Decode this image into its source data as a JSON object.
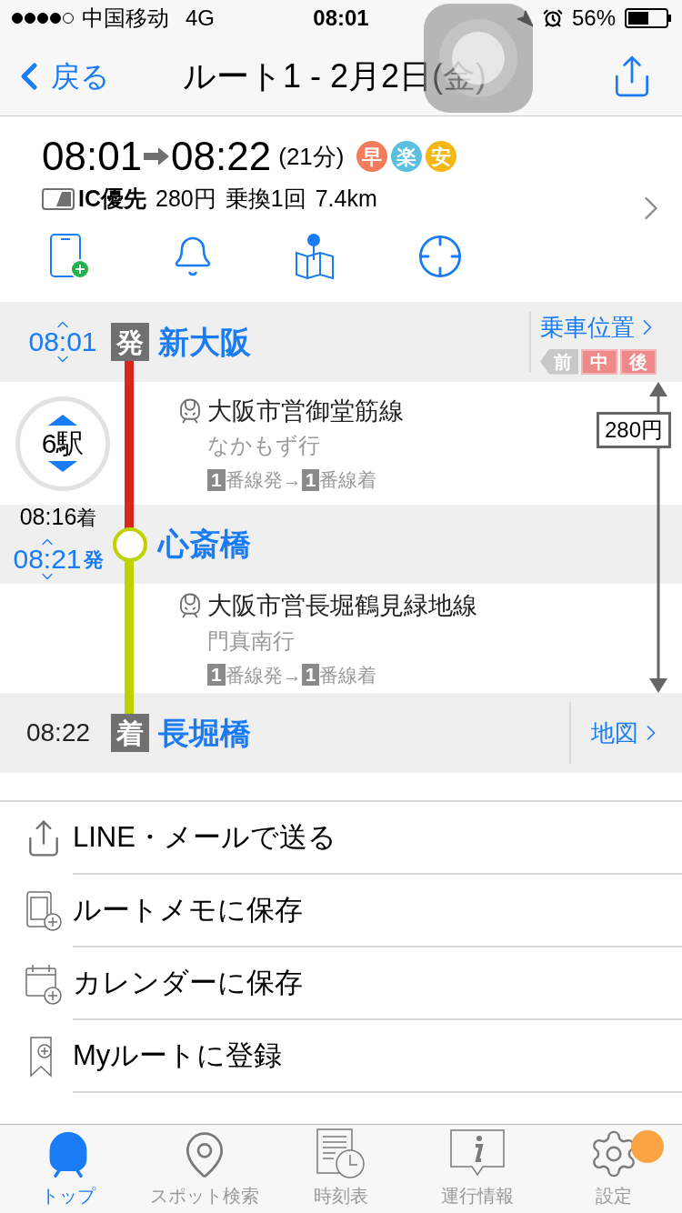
{
  "status_bar": {
    "carrier": "中国移动",
    "network": "4G",
    "time": "08:01",
    "battery": "56%"
  },
  "nav": {
    "back": "戻る",
    "title": "ルート1 - 2月2日(金)"
  },
  "summary": {
    "depart": "08:01",
    "arrive": "08:22",
    "duration": "(21分)",
    "badges": [
      {
        "label": "早",
        "color": "#f47c5c"
      },
      {
        "label": "楽",
        "color": "#5bbfe0"
      },
      {
        "label": "安",
        "color": "#f5b716"
      }
    ],
    "ic_label": "IC優先",
    "fare": "280円",
    "transfers": "乗換1回",
    "distance": "7.4km"
  },
  "route": {
    "origin": {
      "time": "08:01",
      "badge": "発",
      "name": "新大阪",
      "boarding_link": "乗車位置",
      "cars": [
        {
          "label": "前",
          "selected": false
        },
        {
          "label": "中",
          "selected": true
        },
        {
          "label": "後",
          "selected": true
        }
      ]
    },
    "segments": [
      {
        "stops": "6駅",
        "line": "大阪市営御堂筋線",
        "destination": "なかもず行",
        "platform_from": "1",
        "from_text": "番線発→",
        "platform_to": "1",
        "to_text": "番線着",
        "color": "#d9261c"
      },
      {
        "line": "大阪市営長堀鶴見緑地線",
        "destination": "門真南行",
        "platform_from": "1",
        "from_text": "番線発→",
        "platform_to": "1",
        "to_text": "番線着",
        "color": "#bfd200"
      }
    ],
    "transfer": {
      "arrive": "08:16",
      "arrive_suffix": "着",
      "depart": "08:21",
      "depart_suffix": "発",
      "name": "心斎橋"
    },
    "destination": {
      "time": "08:22",
      "badge": "着",
      "name": "長堀橋",
      "map_link": "地図"
    },
    "fare_marker": "280円"
  },
  "actions": [
    {
      "kind": "share",
      "label": "LINE・メールで送る"
    },
    {
      "kind": "memo",
      "label": "ルートメモに保存"
    },
    {
      "kind": "calendar",
      "label": "カレンダーに保存"
    },
    {
      "kind": "bookmark",
      "label": "Myルートに登録"
    }
  ],
  "tabs": [
    {
      "kind": "train",
      "label": "トップ",
      "selected": true,
      "notification": false
    },
    {
      "kind": "spot",
      "label": "スポット検索",
      "selected": false,
      "notification": false
    },
    {
      "kind": "timetable",
      "label": "時刻表",
      "selected": false,
      "notification": false
    },
    {
      "kind": "info",
      "label": "運行情報",
      "selected": false,
      "notification": false
    },
    {
      "kind": "settings",
      "label": "設定",
      "selected": false,
      "notification": true
    }
  ]
}
